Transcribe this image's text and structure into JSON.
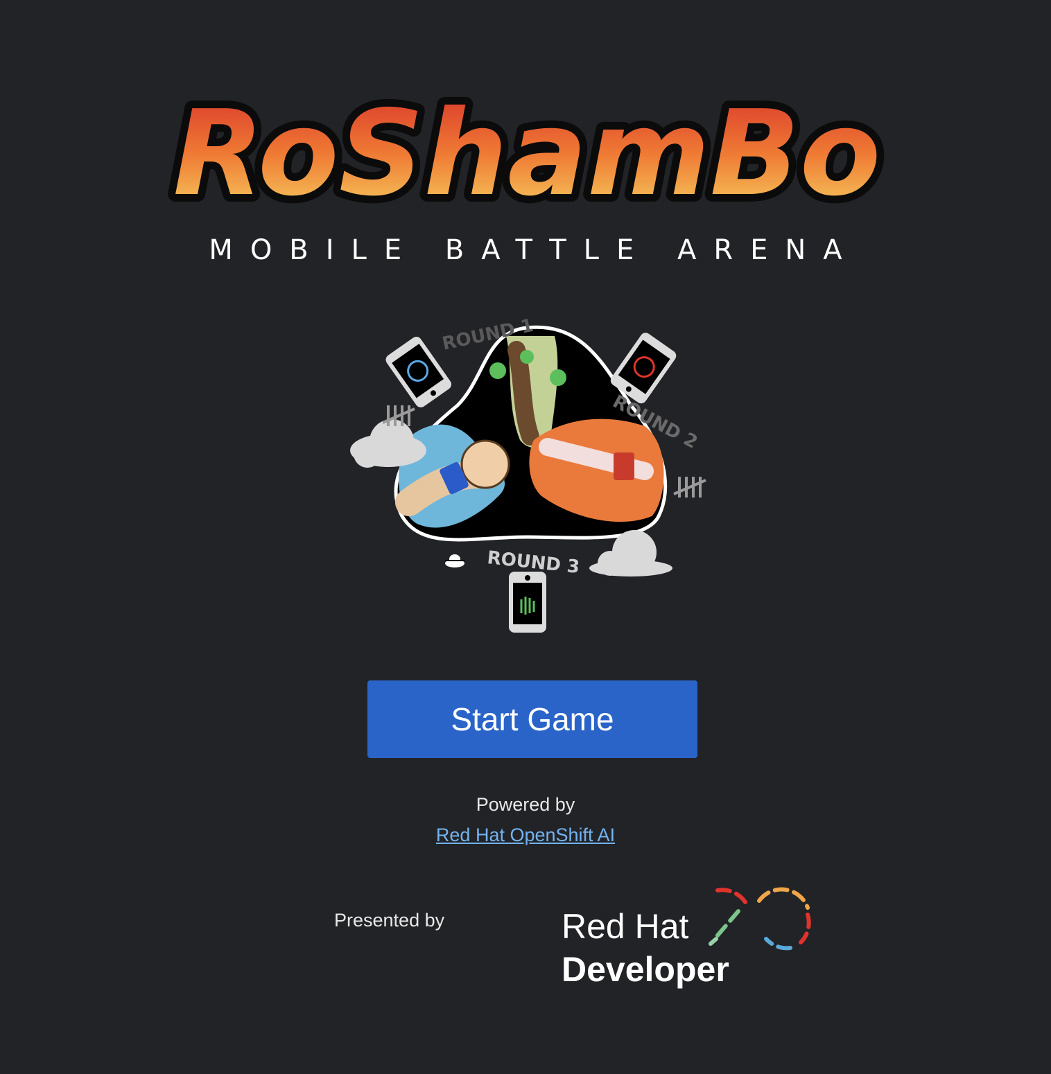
{
  "logo": {
    "title": "RoShamBo",
    "subtitle": "MOBILE BATTLE ARENA"
  },
  "hero": {
    "round1": "ROUND 1",
    "round2": "ROUND 2",
    "round3": "ROUND 3"
  },
  "start_button": {
    "label": "Start Game"
  },
  "credits": {
    "powered_by": "Powered by",
    "powered_link": "Red Hat OpenShift AI",
    "presented_by": "Presented by",
    "brand_line1": "Red Hat",
    "brand_line2": "Developer"
  },
  "colors": {
    "background": "#222327",
    "button": "#2a64c9",
    "link": "#73b3f0"
  }
}
